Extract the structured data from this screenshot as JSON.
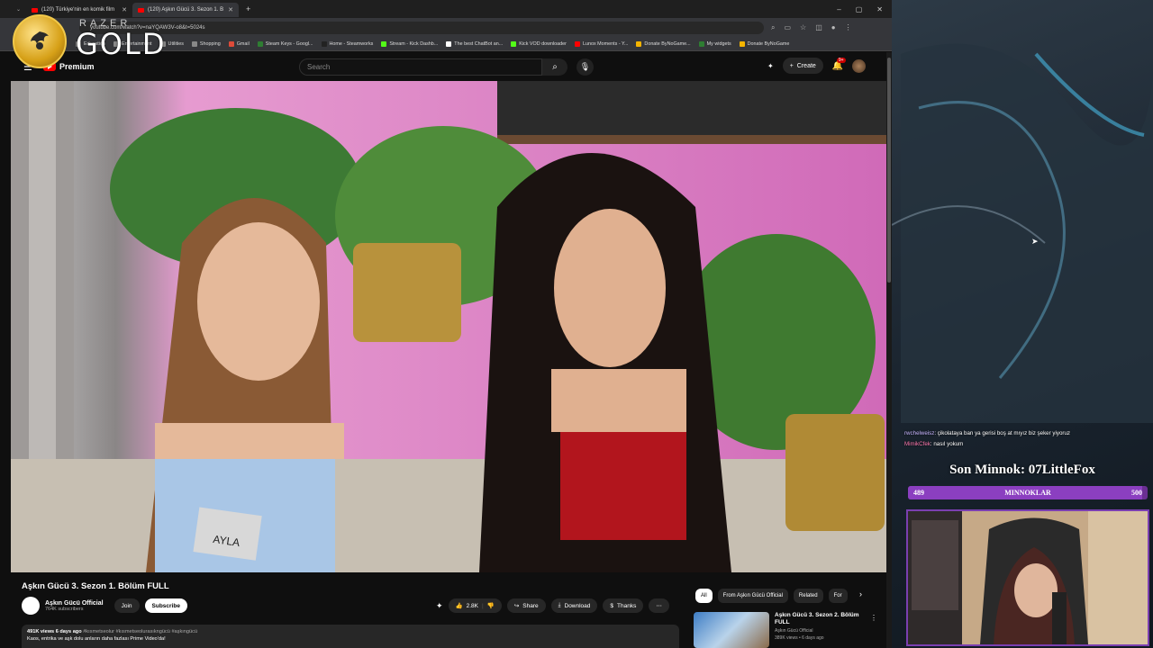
{
  "browser": {
    "tabs": [
      {
        "label": "(120) Türkiye'nin en komik film"
      },
      {
        "label": "(120) Aşkın Gücü 3. Sezon 1. B"
      }
    ],
    "new_tab": "+",
    "window_controls": [
      "–",
      "▢",
      "✕"
    ],
    "url": "youtube.com/watch?v=naYQAW3V-o8&t=5024s",
    "bookmarks": [
      "Education",
      "Entertainment",
      "Utilities",
      "Shopping",
      "Gmail",
      "Steam Keys - Googl...",
      "Home - Steamworks",
      "Stream - Kick Dashb...",
      "The best ChatBot an...",
      "Kick VOD downloader",
      "Lunox Moments - Y...",
      "Donate ByNoGame...",
      "My widgets",
      "Donate ByNoGame"
    ],
    "bookmark_colors": [
      "#888888",
      "#888888",
      "#888888",
      "#888888",
      "#dd4b39",
      "#2e7d32",
      "#222222",
      "#53fc18",
      "#ffffff",
      "#53fc18",
      "#ff0000",
      "#f4b400",
      "#2e7d32",
      "#f4b400"
    ]
  },
  "overlay": {
    "razer_word": "RAZER",
    "gold_label": "GOLD"
  },
  "youtube": {
    "logo_label": "Premium",
    "search_placeholder": "Search",
    "create_label": "Create",
    "notif_badge": "9+",
    "video": {
      "title": "Aşkın Gücü 3. Sezon 1. Bölüm FULL",
      "channel": "Aşkın Gücü Official",
      "subscribers": "764K subscribers",
      "join": "Join",
      "subscribe": "Subscribe",
      "likes": "2.8K",
      "share": "Share",
      "download": "Download",
      "thanks": "Thanks",
      "views_line": "491K views  6 days ago",
      "hashtags": " #kısmetseolur #kısmetseolurasıkngücü #aşkıngücü",
      "desc_line": "Kaos, entrika ve aşk dolu anların daha fazlası Prime Video'da!",
      "name_tag": "AYLA"
    },
    "chips": [
      "All",
      "From Aşkın Gücü Official",
      "Related",
      "For"
    ],
    "related": {
      "title": "Aşkın Gücü 3. Sezon 2. Bölüm FULL",
      "channel": "Aşkın Gücü Official",
      "meta": "389K views • 6 days ago"
    }
  },
  "stream": {
    "chat": [
      {
        "user": "rwchelweisz",
        "message": ": çikolataya ban ya gerisi boş at mıyız biz şeker yiyoruz"
      },
      {
        "user": "MimikCfek",
        "message": ": nasıl yokum"
      }
    ],
    "last_sub_label": "Son Minnok: 07LittleFox",
    "goal": {
      "label": "MINNOKLAR",
      "current": "489",
      "target": "500",
      "progress": 0.978
    }
  }
}
